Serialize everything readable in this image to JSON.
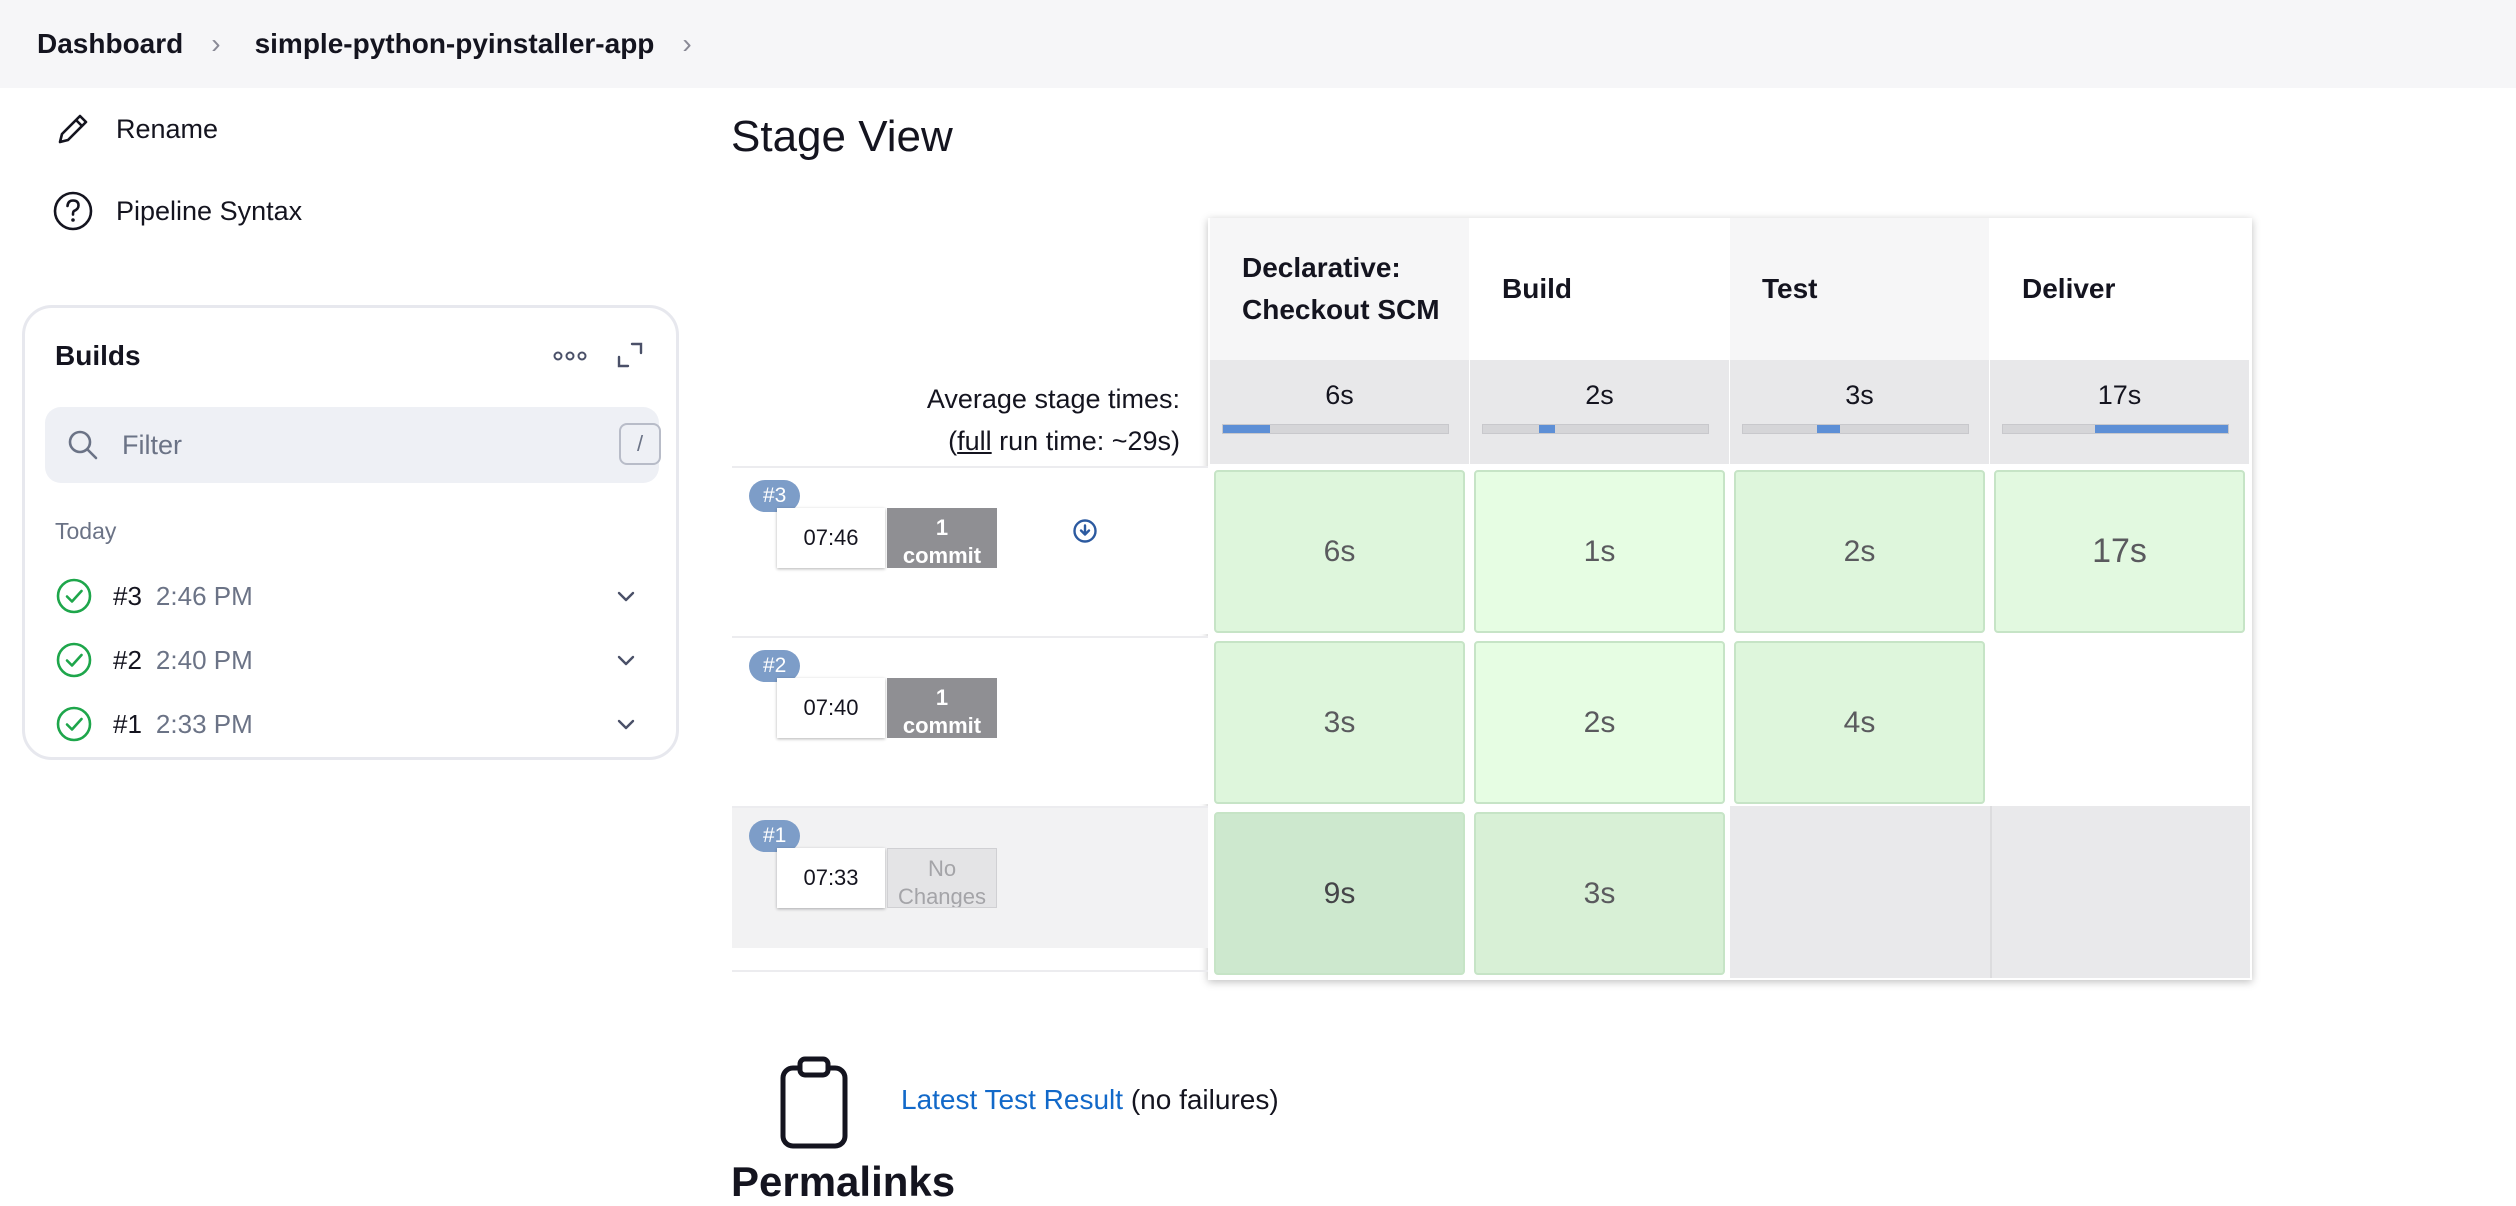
{
  "breadcrumb": {
    "items": [
      "Dashboard",
      "simple-python-pyinstaller-app"
    ]
  },
  "side_tasks": [
    {
      "label": "Rename",
      "icon": "pencil-icon"
    },
    {
      "label": "Pipeline Syntax",
      "icon": "question-circle-icon"
    }
  ],
  "builds": {
    "title": "Builds",
    "filter_placeholder": "Filter",
    "filter_shortcut": "/",
    "group_label": "Today",
    "items": [
      {
        "number": "#3",
        "time": "2:46 PM",
        "status": "success"
      },
      {
        "number": "#2",
        "time": "2:40 PM",
        "status": "success"
      },
      {
        "number": "#1",
        "time": "2:33 PM",
        "status": "success"
      }
    ]
  },
  "stage_view": {
    "title": "Stage View",
    "avg_label_line1": "Average stage times:",
    "avg_label_pre": "(",
    "avg_label_link": "full",
    "avg_label_post": " run time: ~29s)",
    "stages": [
      {
        "name_line1": "Declarative:",
        "name_line2": "Checkout SCM",
        "avg": "6s",
        "avg_fraction": 0.21
      },
      {
        "name_line1": "Build",
        "name_line2": "",
        "avg": "2s",
        "avg_fraction": 0.07
      },
      {
        "name_line1": "Test",
        "name_line2": "",
        "avg": "3s",
        "avg_fraction": 0.1
      },
      {
        "name_line1": "Deliver",
        "name_line2": "",
        "avg": "17s",
        "avg_fraction": 0.59
      }
    ],
    "runs": [
      {
        "badge": "#3",
        "time": "07:46",
        "changes_line1": "1",
        "changes_line2": "commit",
        "cells": [
          "6s",
          "1s",
          "2s",
          "17s"
        ]
      },
      {
        "badge": "#2",
        "time": "07:40",
        "changes_line1": "1",
        "changes_line2": "commit",
        "cells": [
          "3s",
          "2s",
          "4s",
          ""
        ]
      },
      {
        "badge": "#1",
        "time": "07:33",
        "changes_line1": "No",
        "changes_line2": "Changes",
        "cells": [
          "9s",
          "3s",
          "",
          ""
        ]
      }
    ]
  },
  "test_result": {
    "link": "Latest Test Result",
    "suffix": " (no failures)"
  },
  "permalinks": {
    "title": "Permalinks"
  },
  "colors": {
    "success_green": "#1ea64b",
    "link_blue": "#1269c9",
    "stage_bar_blue": "#5d8fd6",
    "cell_green": "#e2f9e0",
    "cell_green_dark": "#cde8ce",
    "badge_blue": "#7d9dc8"
  }
}
